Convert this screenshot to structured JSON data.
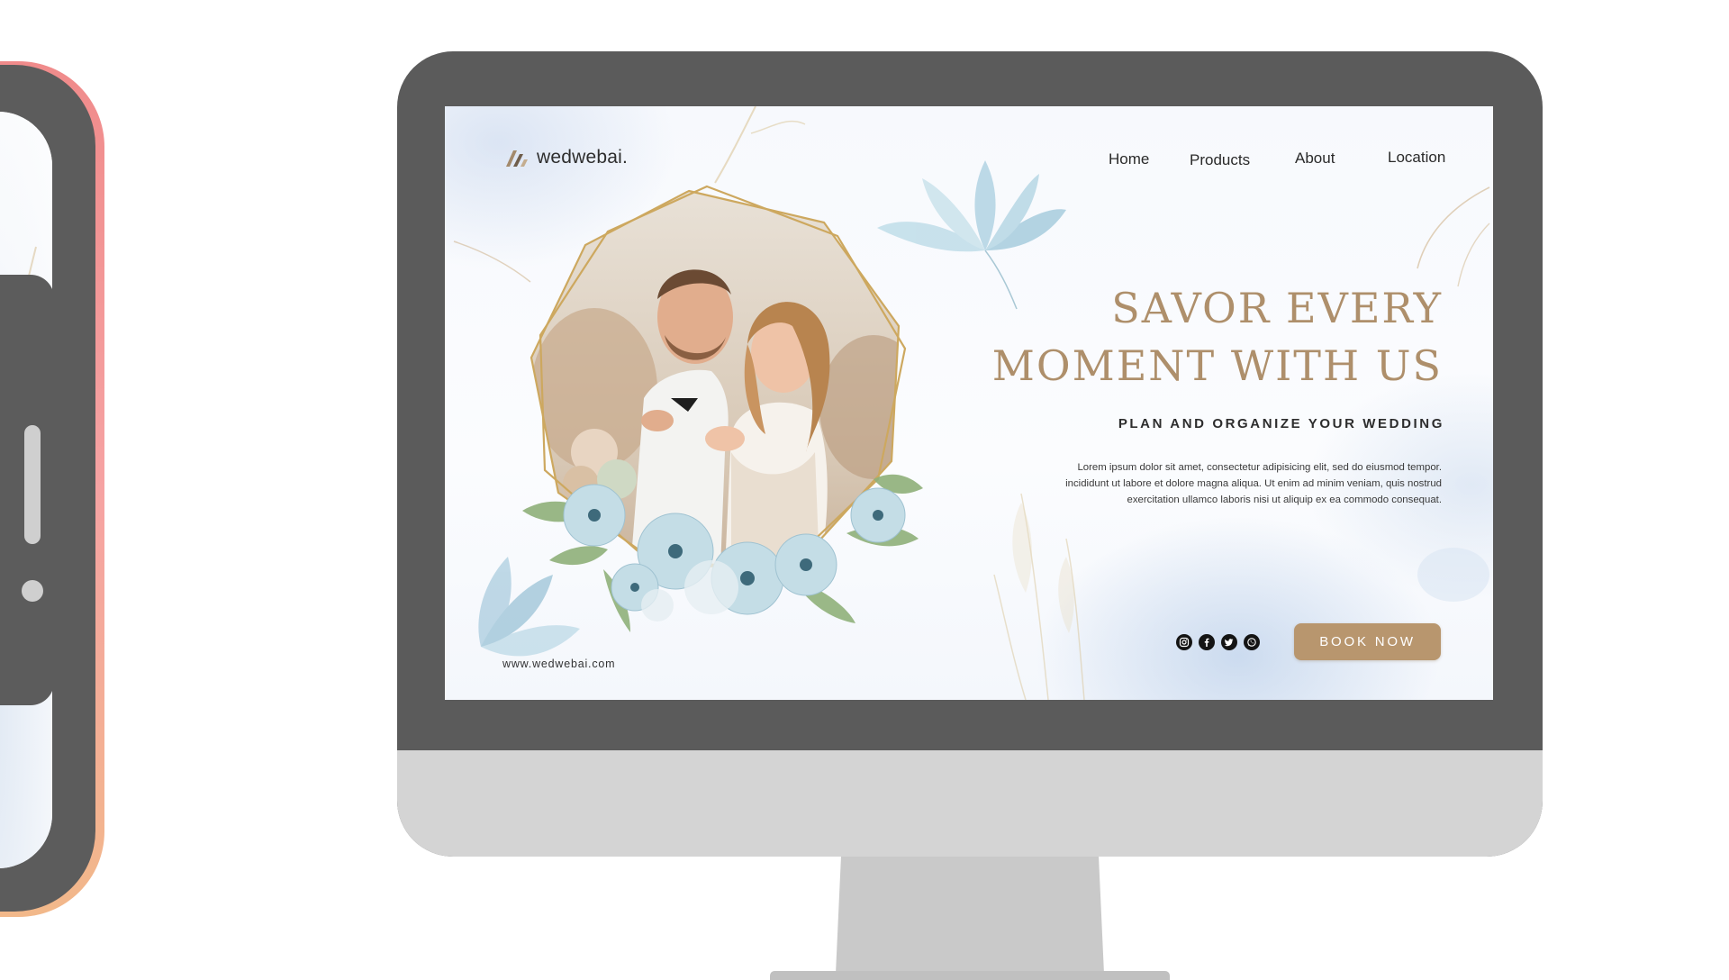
{
  "site": {
    "brand": "wedwebai.",
    "url": "www.wedwebai.com"
  },
  "nav": {
    "items": [
      {
        "label": "Home"
      },
      {
        "label": "Products"
      },
      {
        "label": "About"
      },
      {
        "label": "Location"
      }
    ]
  },
  "hero": {
    "headline_line1": "SAVOR EVERY",
    "headline_line2": "MOMENT WITH US",
    "subheadline": "PLAN AND ORGANIZE YOUR WEDDING",
    "body_line1": "Lorem ipsum dolor sit amet, consectetur adipisicing elit, sed do eiusmod tempor.",
    "body_line2": "incididunt ut labore et dolore magna aliqua. Ut enim ad minim veniam, quis nostrud",
    "body_line3": "exercitation ullamco laboris nisi ut aliquip ex ea commodo consequat.",
    "cta_label": "BOOK NOW"
  },
  "social": {
    "icons": [
      "instagram-icon",
      "facebook-icon",
      "twitter-icon",
      "whatsapp-icon"
    ]
  },
  "colors": {
    "accent_gold": "#ae8f6b",
    "button": "#b8966e",
    "monitor_bezel": "#5b5b5b",
    "monitor_chin": "#d4d4d4",
    "phone_edge": "#f08b8b"
  }
}
